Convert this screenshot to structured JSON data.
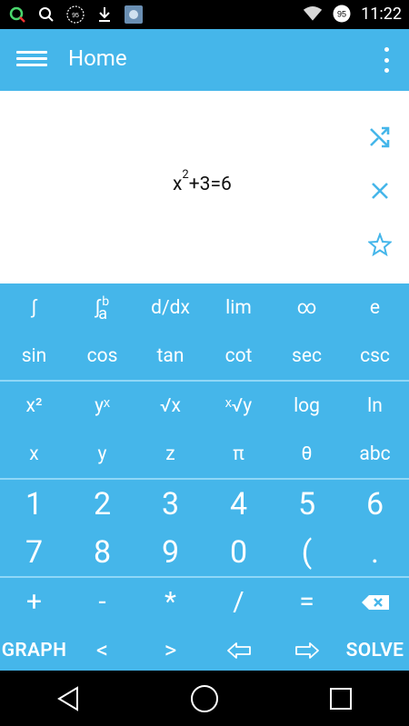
{
  "status_bar": {
    "time": "11:22",
    "battery_level": "95",
    "download_level": "95",
    "icons": [
      "search-icon",
      "search-icon",
      "battery-status-icon",
      "download-icon",
      "screenshot-icon",
      "wifi-icon"
    ]
  },
  "app_bar": {
    "title": "Home",
    "menu_icon": "hamburger-menu-icon",
    "overflow_icon": "more-vert-icon"
  },
  "display": {
    "expression_base": "x",
    "expression_exp": "2",
    "expression_rest": "+3=6",
    "side_icons": [
      "shuffle-icon",
      "clear-icon",
      "star-icon"
    ]
  },
  "keypad": {
    "row1": [
      "∫",
      "∫ab",
      "d/dx",
      "lim",
      "∞",
      "e"
    ],
    "row2": [
      "sin",
      "cos",
      "tan",
      "cot",
      "sec",
      "csc"
    ],
    "row3": [
      "x²",
      "yˣ",
      "√x",
      "ˣ√y",
      "log",
      "ln"
    ],
    "row4": [
      "x",
      "y",
      "z",
      "π",
      "θ",
      "abc"
    ],
    "row5": [
      "1",
      "2",
      "3",
      "4",
      "5",
      "6"
    ],
    "row6": [
      "7",
      "8",
      "9",
      "0",
      "(",
      "."
    ],
    "row7": [
      "+",
      "-",
      "*",
      "/",
      "=",
      "backspace-icon"
    ],
    "row8": [
      "GRAPH",
      "<",
      ">",
      "left-arrow-icon",
      "right-arrow-icon",
      "SOLVE"
    ]
  },
  "nav_bar": {
    "icons": [
      "back-icon",
      "home-icon",
      "recent-apps-icon"
    ]
  },
  "colors": {
    "accent": "#45b6ea",
    "separator": "#8fd7f7",
    "text_dark": "#111111",
    "icon_blue": "#45b6ea"
  }
}
